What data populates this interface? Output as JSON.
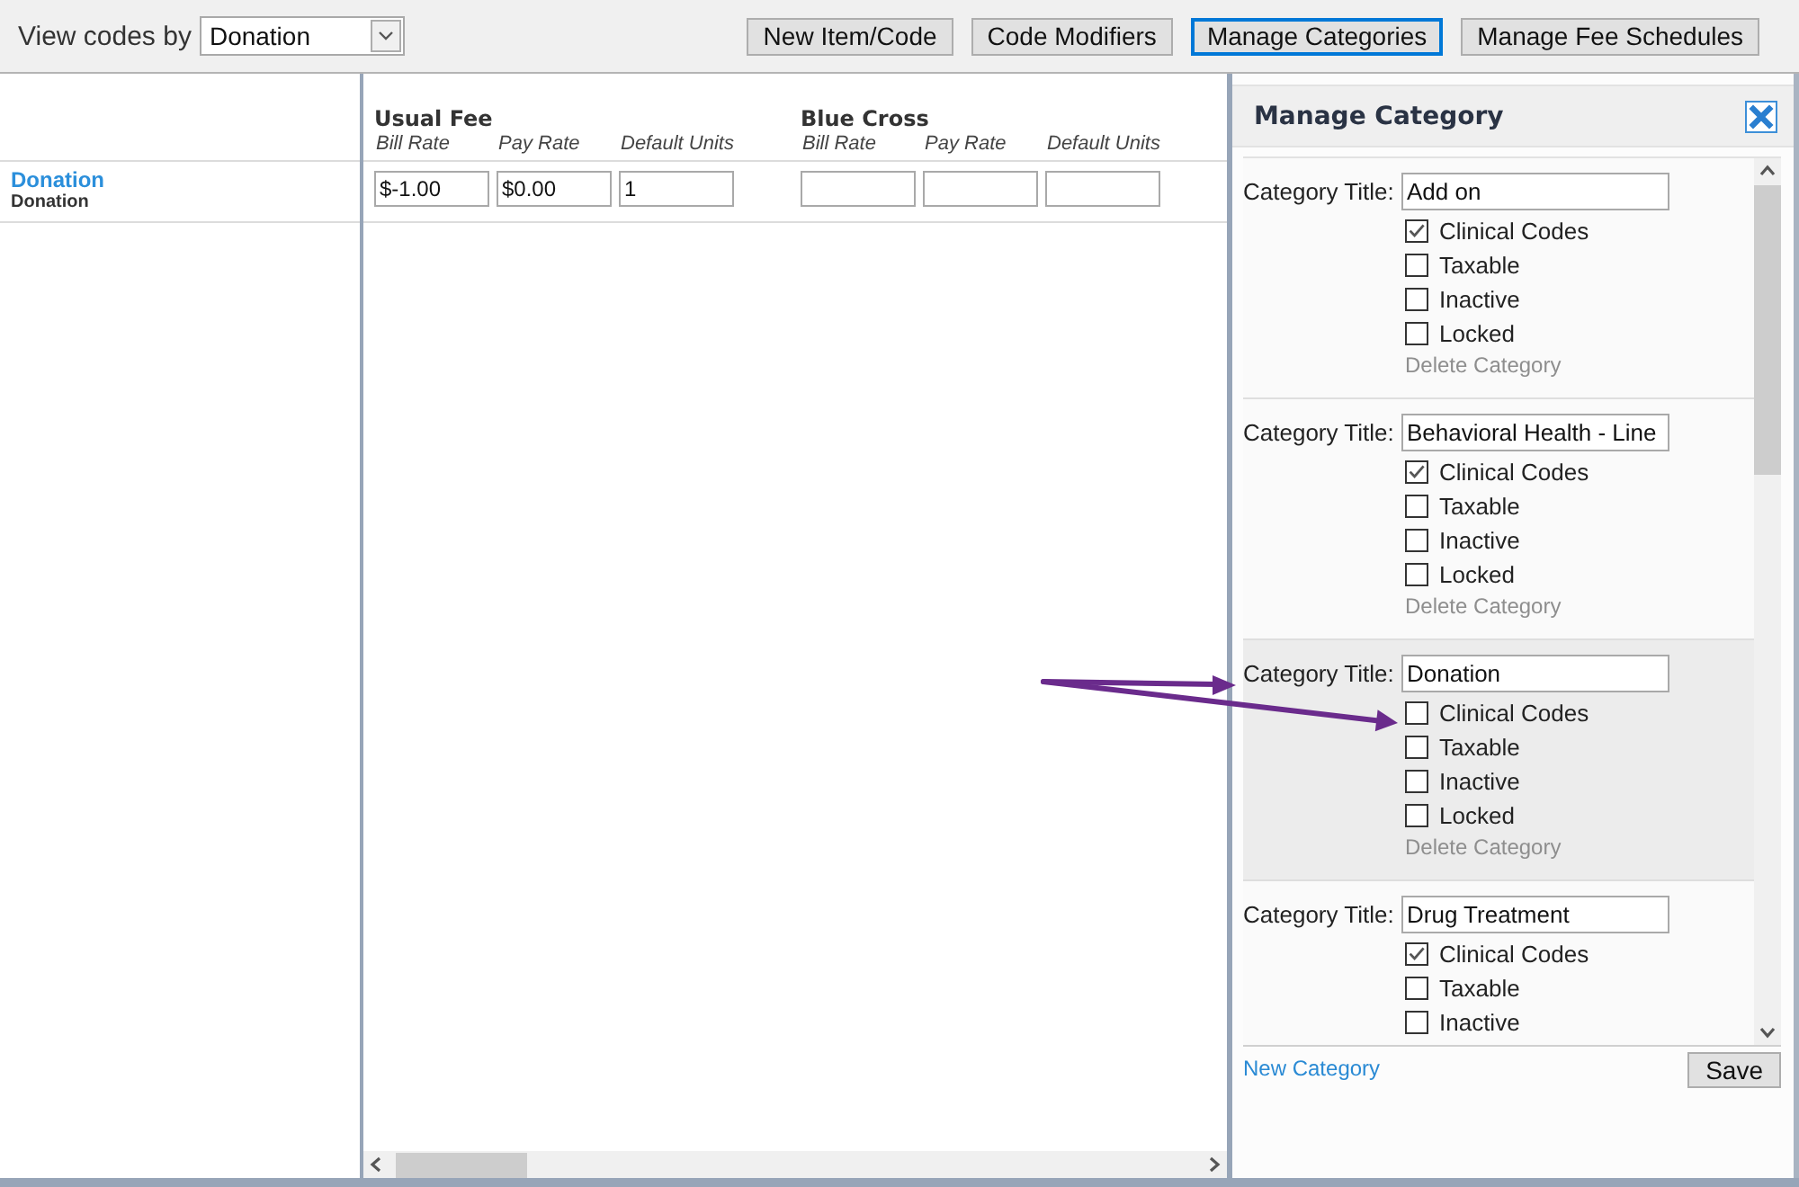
{
  "toolbar": {
    "view_label": "View codes by",
    "view_value": "Donation",
    "buttons": [
      {
        "label": "New Item/Code",
        "focused": false
      },
      {
        "label": "Code Modifiers",
        "focused": false
      },
      {
        "label": "Manage Categories",
        "focused": true
      },
      {
        "label": "Manage Fee Schedules",
        "focused": false
      }
    ]
  },
  "schedules": [
    {
      "name": "Usual Fee",
      "columns": [
        "Bill Rate",
        "Pay Rate",
        "Default Units"
      ]
    },
    {
      "name": "Blue Cross",
      "columns": [
        "Bill Rate",
        "Pay Rate",
        "Default Units"
      ]
    }
  ],
  "rows": [
    {
      "title": "Donation",
      "subtitle": "Donation",
      "values": [
        "$-1.00",
        "$0.00",
        "1"
      ]
    }
  ],
  "panel": {
    "title": "Manage Category",
    "categories": [
      {
        "label": "Category Title:",
        "title": "Add on",
        "highlighted": false,
        "options": [
          {
            "label": "Clinical Codes",
            "checked": true
          },
          {
            "label": "Taxable",
            "checked": false
          },
          {
            "label": "Inactive",
            "checked": false
          },
          {
            "label": "Locked",
            "checked": false
          }
        ],
        "delete": {
          "label": "Delete Category",
          "disabled": true
        }
      },
      {
        "label": "Category Title:",
        "title": "Behavioral Health - Line",
        "highlighted": false,
        "options": [
          {
            "label": "Clinical Codes",
            "checked": true
          },
          {
            "label": "Taxable",
            "checked": false
          },
          {
            "label": "Inactive",
            "checked": false
          },
          {
            "label": "Locked",
            "checked": false
          }
        ],
        "delete": {
          "label": "Delete Category",
          "disabled": true
        }
      },
      {
        "label": "Category Title:",
        "title": "Donation",
        "highlighted": true,
        "options": [
          {
            "label": "Clinical Codes",
            "checked": false
          },
          {
            "label": "Taxable",
            "checked": false
          },
          {
            "label": "Inactive",
            "checked": false
          },
          {
            "label": "Locked",
            "checked": false
          }
        ],
        "delete": {
          "label": "Delete Category",
          "disabled": true
        }
      },
      {
        "label": "Category Title:",
        "title": "Drug Treatment",
        "highlighted": false,
        "options": [
          {
            "label": "Clinical Codes",
            "checked": true
          },
          {
            "label": "Taxable",
            "checked": false
          },
          {
            "label": "Inactive",
            "checked": false
          }
        ]
      }
    ],
    "new_link": "New Category",
    "save_label": "Save"
  }
}
